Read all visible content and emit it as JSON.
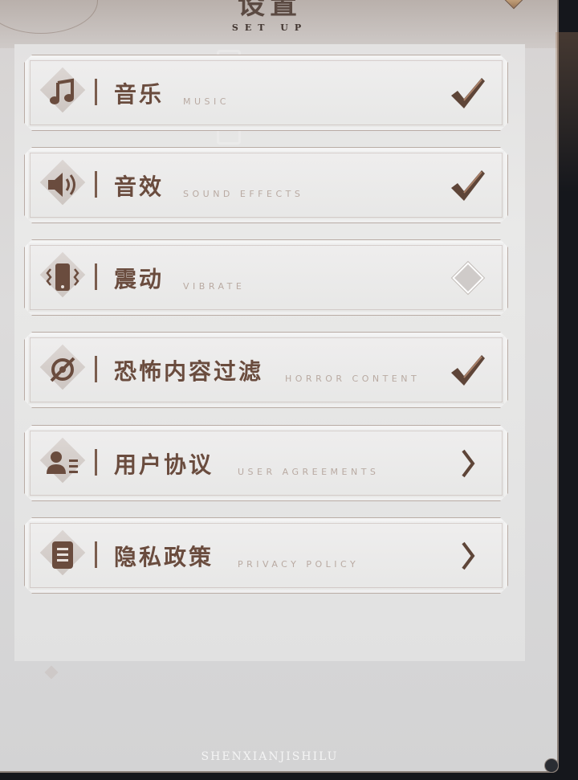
{
  "header": {
    "title": "设置",
    "subtitle": "SET UP"
  },
  "colors": {
    "accent": "#6a4c3e",
    "check": "#5e4538",
    "panel": "#e7e7e6"
  },
  "settings": [
    {
      "label": "音乐",
      "sub": "MUSIC",
      "icon": "music-note-icon",
      "control": "check",
      "enabled": true
    },
    {
      "label": "音效",
      "sub": "SOUND EFFECTS",
      "icon": "speaker-icon",
      "control": "check",
      "enabled": true
    },
    {
      "label": "震动",
      "sub": "VIBRATE",
      "icon": "vibrate-phone-icon",
      "control": "diamond",
      "enabled": false
    },
    {
      "label": "恐怖内容过滤",
      "sub": "HORROR CONTENT",
      "icon": "eye-slash-icon",
      "control": "check",
      "enabled": true
    },
    {
      "label": "用户协议",
      "sub": "USER AGREEMENTS",
      "icon": "user-card-icon",
      "control": "arrow",
      "enabled": null
    },
    {
      "label": "隐私政策",
      "sub": "PRIVACY POLICY",
      "icon": "document-icon",
      "control": "arrow",
      "enabled": null
    }
  ],
  "footer": {
    "watermark": "SHENXIANJISHILU"
  }
}
